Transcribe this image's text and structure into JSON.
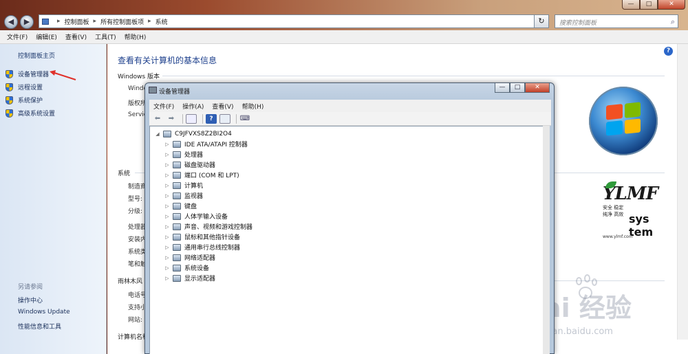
{
  "explorer": {
    "address": [
      "控制面板",
      "所有控制面板项",
      "系统"
    ],
    "search_placeholder": "搜索控制面板",
    "window_controls": [
      "—",
      "□",
      "✕"
    ],
    "nav_back": "◀",
    "nav_forward": "▶",
    "refresh": "↻",
    "menu": [
      "文件(F)",
      "编辑(E)",
      "查看(V)",
      "工具(T)",
      "帮助(H)"
    ]
  },
  "sidebar": {
    "home": "控制面板主页",
    "items": [
      "设备管理器",
      "远程设置",
      "系统保护",
      "高级系统设置"
    ],
    "see_also_title": "另请参阅",
    "links": [
      "操作中心",
      "Windows Update",
      "性能信息和工具"
    ]
  },
  "main": {
    "title": "查看有关计算机的基本信息",
    "windows_edition_heading": "Windows 版本",
    "windows_edition_rows": [
      "Windo",
      "版权所",
      "Servic"
    ],
    "system_heading": "系统",
    "system_rows": [
      "制造商",
      "型号:",
      "分级:",
      "处理器",
      "安装内",
      "系统类",
      "笔和触"
    ],
    "support_heading": "雨林木风",
    "support_rows": [
      "电话号",
      "支持小",
      "网站:"
    ],
    "computer_name_heading": "计算机名称",
    "ylmf": {
      "logo": "YLMF",
      "tagline_1": "安全  稳定",
      "tagline_2": "纯净  高效",
      "sys_text": "sys tem",
      "url": "www.ylmf.com"
    },
    "watermark": {
      "text": "Bai 经验",
      "url": "jingyan.baidu.com"
    }
  },
  "device_manager": {
    "title": "设备管理器",
    "window_controls": [
      "—",
      "□",
      "✕"
    ],
    "menu": [
      "文件(F)",
      "操作(A)",
      "查看(V)",
      "帮助(H)"
    ],
    "root": "C9JFVXS8Z2BI2O4",
    "nodes": [
      "IDE ATA/ATAPI 控制器",
      "处理器",
      "磁盘驱动器",
      "端口 (COM 和 LPT)",
      "计算机",
      "监视器",
      "键盘",
      "人体学输入设备",
      "声音、视频和游戏控制器",
      "鼠标和其他指针设备",
      "通用串行总线控制器",
      "网络适配器",
      "系统设备",
      "显示适配器"
    ]
  },
  "colors": {
    "link": "#1a2f5a",
    "heading": "#1c3f8c",
    "annotation_arrow": "#e0302a"
  }
}
